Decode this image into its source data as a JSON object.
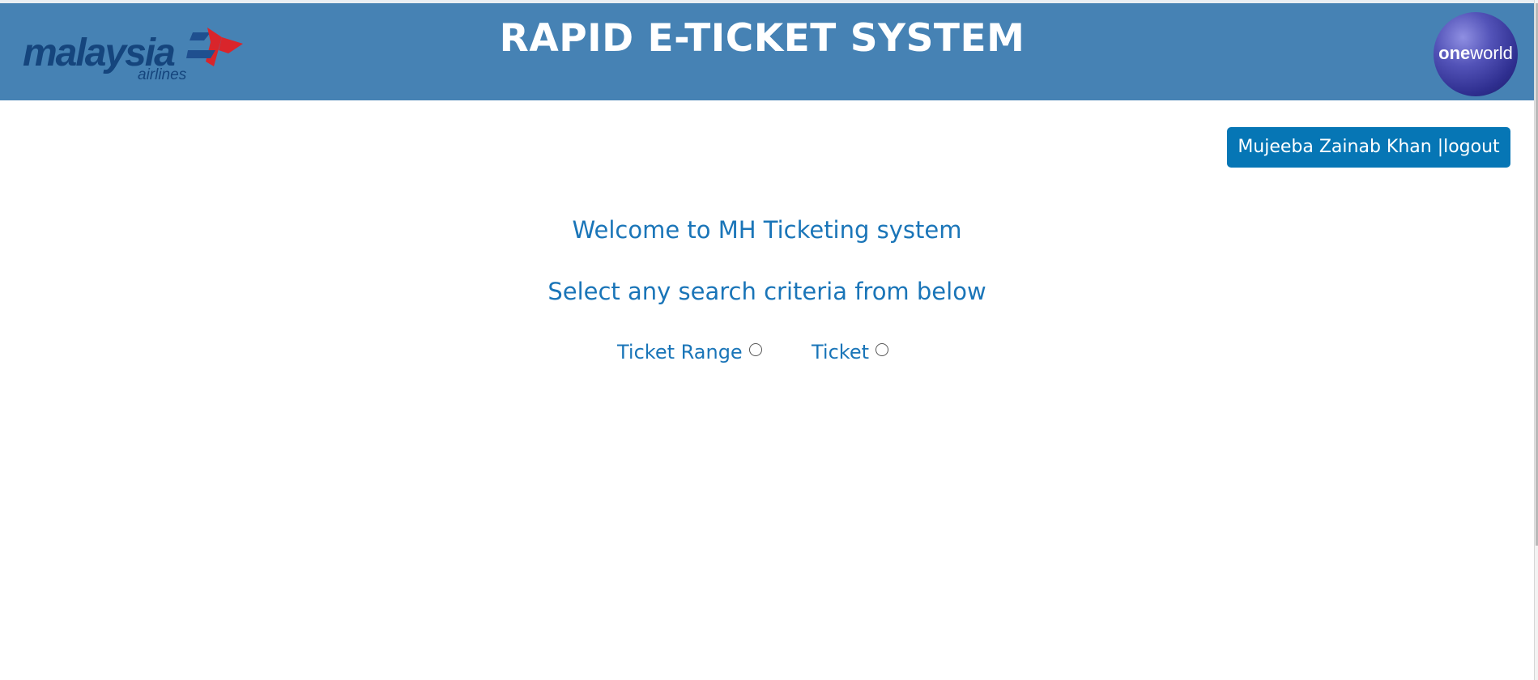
{
  "header": {
    "title": "RAPID E-TICKET SYSTEM",
    "logo_text": "malaysia",
    "logo_subtext": "airlines",
    "alliance_logo": {
      "bold": "one",
      "regular": "world"
    },
    "background_color": "#4682b4"
  },
  "user": {
    "label": "Mujeeba Zainab Khan |logout",
    "button_color": "#0676b5"
  },
  "main": {
    "welcome": "Welcome to MH Ticketing system",
    "instruction": "Select any search criteria from below",
    "text_color": "#1a75b8",
    "options": [
      {
        "label": "Ticket Range",
        "selected": false
      },
      {
        "label": "Ticket",
        "selected": false
      }
    ]
  }
}
